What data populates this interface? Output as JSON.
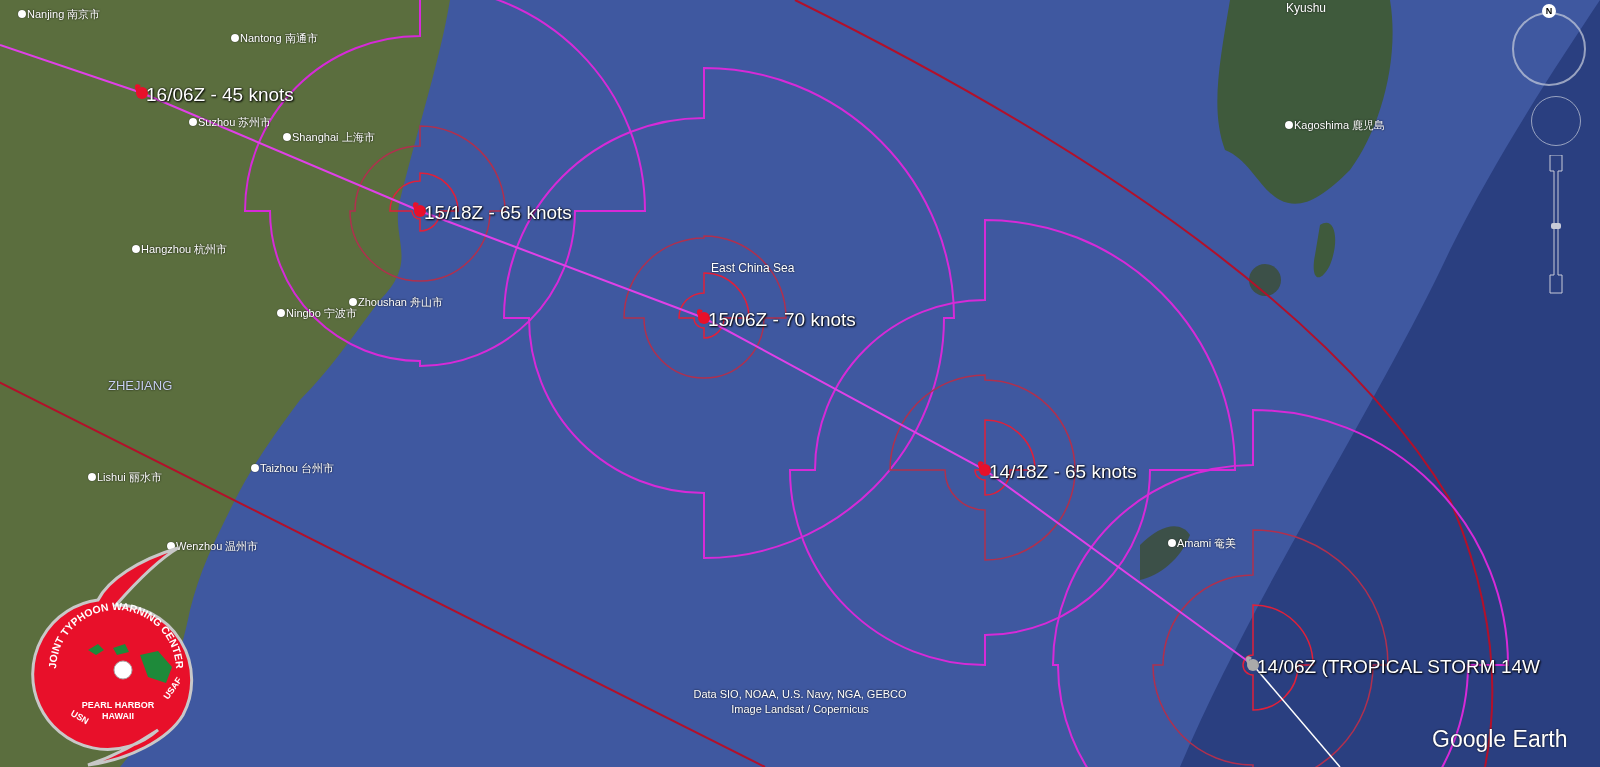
{
  "map": {
    "places": [
      {
        "name": "Nanjing 南京市"
      },
      {
        "name": "Nantong 南通市"
      },
      {
        "name": "Suzhou 苏州市"
      },
      {
        "name": "Shanghai 上海市"
      },
      {
        "name": "Hangzhou 杭州市"
      },
      {
        "name": "Ningbo 宁波市"
      },
      {
        "name": "Zhoushan 舟山市"
      },
      {
        "name": "Lishui 丽水市"
      },
      {
        "name": "Taizhou 台州市"
      },
      {
        "name": "Wenzhou 温州市"
      },
      {
        "name": "Kagoshima 鹿児島"
      },
      {
        "name": "Amami 奄美"
      }
    ],
    "region_labels": [
      "ZHEJIANG",
      "Kyushu"
    ],
    "sea_labels": [
      "East China Sea"
    ]
  },
  "forecast_track": {
    "points": [
      {
        "label": "16/06Z - 45 knots",
        "kind": "forecast"
      },
      {
        "label": "15/18Z - 65 knots",
        "kind": "forecast"
      },
      {
        "label": "15/06Z - 70 knots",
        "kind": "forecast"
      },
      {
        "label": "14/18Z - 65 knots",
        "kind": "forecast"
      },
      {
        "label": "14/06Z (TROPICAL STORM 14W",
        "kind": "current"
      }
    ]
  },
  "logo": {
    "title": "JOINT TYPHOON WARNING CENTER",
    "location_lines": [
      "PEARL HARBOR",
      "HAWAII"
    ],
    "left_mark": "USN",
    "right_mark": "USAF"
  },
  "compass": {
    "north": "N"
  },
  "zoom_slider": {
    "level": 0.5
  },
  "attribution": [
    "Data SIO, NOAA, U.S. Navy, NGA, GEBCO",
    "Image Landsat / Copernicus"
  ],
  "brand": "Google Earth"
}
